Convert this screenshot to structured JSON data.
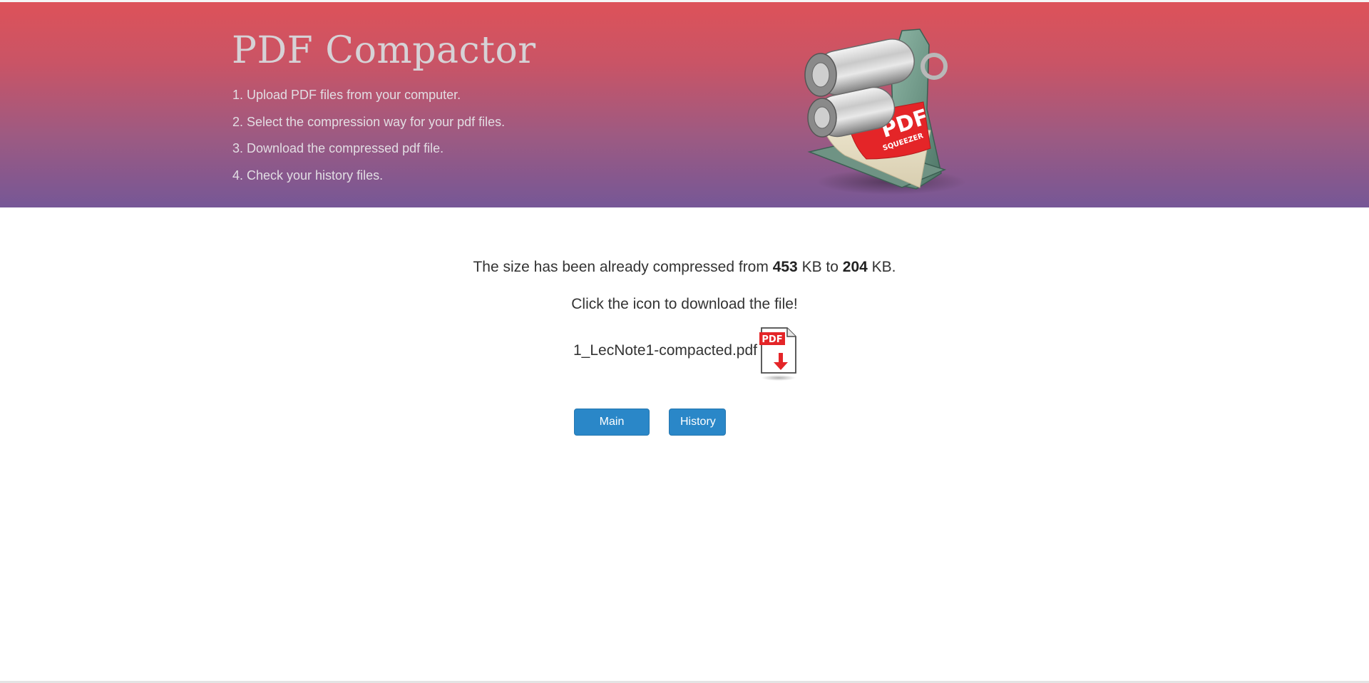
{
  "header": {
    "title": "PDF Compactor",
    "steps": [
      "1. Upload PDF files from your computer.",
      "2. Select the compression way for your pdf files.",
      "3. Download the compressed pdf file.",
      "4. Check your history files."
    ],
    "logo": {
      "icon": "pdf-squeezer-logo",
      "label_main": "PDF",
      "label_sub": "SQUEEZER"
    }
  },
  "result": {
    "prefix": "The size has been already compressed from ",
    "original_size": "453",
    "middle": " KB to ",
    "compressed_size": "204",
    "suffix": " KB.",
    "instruction": "Click the icon to download the file!",
    "filename": "1_LecNote1-compacted.pdf",
    "download_icon": {
      "icon": "pdf-download-icon",
      "label": "PDF"
    }
  },
  "buttons": {
    "main_page": "Main page",
    "history": "History"
  },
  "colors": {
    "hero_top": "#dd5259",
    "hero_bottom": "#765796",
    "button": "#2a87c8",
    "pdf_red": "#e42528"
  }
}
